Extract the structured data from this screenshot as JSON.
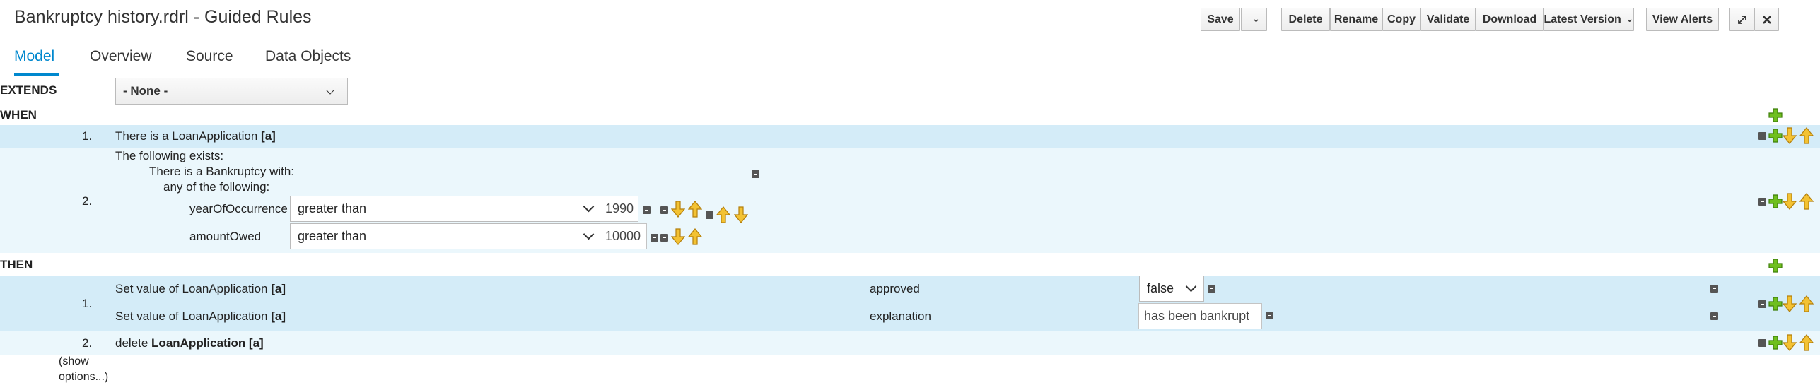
{
  "header": {
    "title": "Bankruptcy history.rdrl - Guided Rules",
    "buttons": {
      "save": "Save",
      "delete": "Delete",
      "rename": "Rename",
      "copy": "Copy",
      "validate": "Validate",
      "download": "Download",
      "latest_version": "Latest Version",
      "view_alerts": "View Alerts"
    }
  },
  "tabs": [
    "Model",
    "Overview",
    "Source",
    "Data Objects"
  ],
  "extends": {
    "label": "EXTENDS",
    "value": "- None -"
  },
  "when": {
    "label": "WHEN",
    "rows": [
      {
        "num": "1.",
        "text_prefix": "There is a LoanApplication ",
        "text_bold": "[a]"
      },
      {
        "num": "2.",
        "exists": "The following exists:",
        "bankruptcy": "There is a Bankruptcy with:",
        "any_of": "any of the following:",
        "conditions": [
          {
            "field": "yearOfOccurrence",
            "operator": "greater than",
            "value": "1990"
          },
          {
            "field": "amountOwed",
            "operator": "greater than",
            "value": "10000"
          }
        ]
      }
    ]
  },
  "then": {
    "label": "THEN",
    "rows": [
      {
        "num": "1.",
        "actions": [
          {
            "text_prefix": "Set value of LoanApplication ",
            "text_bold": "[a]",
            "field": "approved",
            "value": "false"
          },
          {
            "text_prefix": "Set value of LoanApplication ",
            "text_bold": "[a]",
            "field": "explanation",
            "value": "has been bankrupt"
          }
        ]
      },
      {
        "num": "2.",
        "text_prefix": "delete ",
        "text_bold": "LoanApplication [a]"
      }
    ]
  },
  "show_options": [
    "(show",
    "options...)"
  ],
  "colors": {
    "accent": "#0088ce",
    "row_blue": "#d4ecf8",
    "row_light": "#ebf7fc",
    "icon_green": "#5aa800",
    "icon_gold": "#e6a817"
  }
}
